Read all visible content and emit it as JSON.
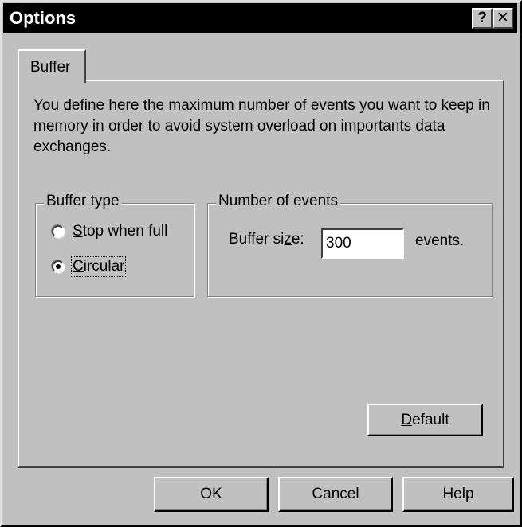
{
  "window": {
    "title": "Options",
    "help_glyph": "?",
    "close_glyph": "✕"
  },
  "tabs": [
    {
      "label": "Buffer",
      "selected": true
    }
  ],
  "description": "You define here the maximum number of events you want to keep in memory in order to avoid system overload on importants data exchanges.",
  "buffer_type": {
    "label": "Buffer type",
    "options": [
      {
        "mnemonic": "S",
        "rest": "top when full",
        "checked": false
      },
      {
        "mnemonic": "C",
        "rest": "ircular",
        "checked": true
      }
    ]
  },
  "number_of_events": {
    "label": "Number of events",
    "size_label_prefix": "Buffer si",
    "size_label_mnemonic": "z",
    "size_label_suffix": "e:",
    "size_value": "300",
    "unit": "events."
  },
  "buttons": {
    "default_mnemonic": "D",
    "default_rest": "efault",
    "ok": "OK",
    "cancel": "Cancel",
    "help": "Help"
  }
}
